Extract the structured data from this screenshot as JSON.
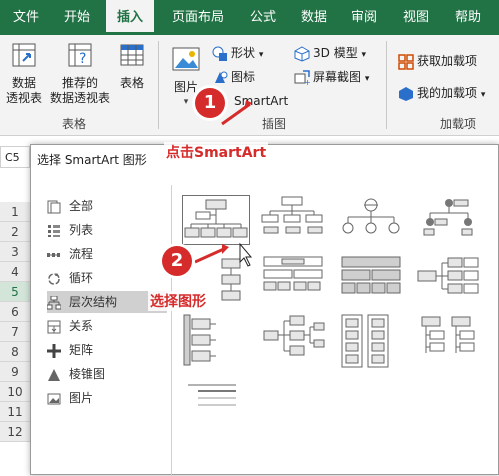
{
  "ribbon": {
    "tabs": [
      "文件",
      "开始",
      "插入",
      "页面布局",
      "公式",
      "数据",
      "审阅",
      "视图",
      "帮助"
    ],
    "active_tab": "插入",
    "tables_group": {
      "pivot": "数据\n透视表",
      "recommended": "推荐的\n数据透视表",
      "table": "表格",
      "label": "表格"
    },
    "illustrations_group": {
      "pictures": "图片",
      "shapes": "形状",
      "icons": "图标",
      "smartart": "SmartArt",
      "model3d": "3D 模型",
      "screenshot": "屏幕截图",
      "label": "插图"
    },
    "addins_group": {
      "get": "获取加载项",
      "mine": "我的加载项",
      "label": "加载项"
    }
  },
  "sheet": {
    "namebox": "C5",
    "rows": [
      "1",
      "2",
      "3",
      "4",
      "5",
      "6",
      "7",
      "8",
      "9",
      "10",
      "11",
      "12"
    ],
    "selected_row": "5"
  },
  "dialog": {
    "title": "选择 SmartArt 图形",
    "categories": [
      {
        "label": "全部",
        "icon": "all-icon"
      },
      {
        "label": "列表",
        "icon": "list-icon"
      },
      {
        "label": "流程",
        "icon": "process-icon"
      },
      {
        "label": "循环",
        "icon": "cycle-icon"
      },
      {
        "label": "层次结构",
        "icon": "hierarchy-icon"
      },
      {
        "label": "关系",
        "icon": "relationship-icon"
      },
      {
        "label": "矩阵",
        "icon": "matrix-icon"
      },
      {
        "label": "棱锥图",
        "icon": "pyramid-icon"
      },
      {
        "label": "图片",
        "icon": "picture-icon"
      }
    ],
    "selected_category": "层次结构"
  },
  "annotations": {
    "step1_number": "1",
    "step1_text": "点击SmartArt",
    "step2_number": "2",
    "step2_text": "选择图形",
    "color": "#d62b2b"
  }
}
